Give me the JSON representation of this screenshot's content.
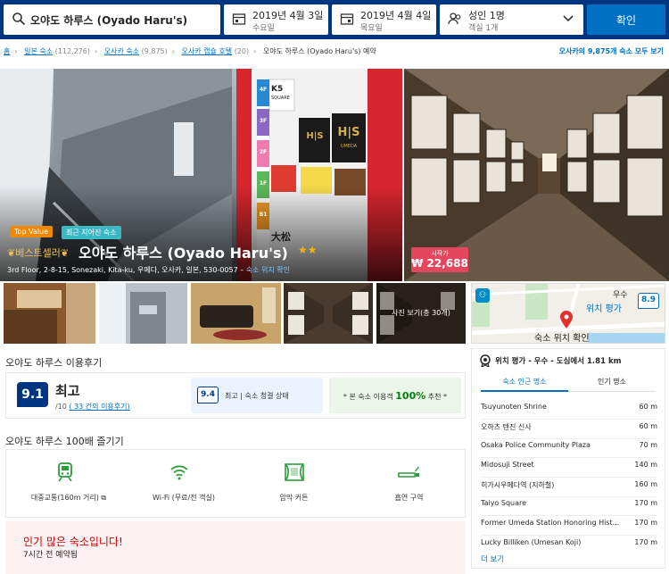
{
  "search": {
    "destination": "오야도 하루스 (Oyado Haru's)",
    "checkin_date": "2019년 4월 3일",
    "checkin_day": "수요일",
    "checkout_date": "2019년 4월 4일",
    "checkout_day": "목요일",
    "guests": "성인 1명",
    "rooms": "객실 1개",
    "submit_label": "확인"
  },
  "breadcrumb": {
    "items": [
      {
        "label": "홈",
        "count": ""
      },
      {
        "label": "일본 숙소",
        "count": "(112,276)"
      },
      {
        "label": "오사카 숙소",
        "count": "(9,875)"
      },
      {
        "label": "오사카 캡슐 호텔",
        "count": "(20)"
      }
    ],
    "current": "오야도 하루스 (Oyado Haru's) 예약",
    "all_properties_link": "오사카의 9,875개 숙소 모두 보기"
  },
  "hotel": {
    "badge_top_value": "Top Value",
    "badge_recent": "최근 지어진 숙소",
    "bestseller": "베스트셀러",
    "name": "오야도 하루스 (Oyado Haru's)",
    "stars": "★★",
    "address": "3rd Floor, 2-8-15, Sonezaki, Kita-ku, 우메다, 오사카, 일본, 530-0057",
    "address_link": "숙소 위치 확인",
    "price_from_label": "시작가",
    "price": "₩ 22,688",
    "photos_label": "사진 보기(총 30개)"
  },
  "hero_signs": {
    "floors": [
      "4F",
      "3F",
      "2F",
      "1F",
      "B1"
    ],
    "ks_square": "K5",
    "ks_sub": "SQUARE",
    "hs": "H|S",
    "hs_sub": "UMEDA",
    "daimaru": "大松"
  },
  "map": {
    "region_label": "우수",
    "region_score_label": "위치 평가",
    "score": "8.9",
    "check_location": "숙소 위치 확인"
  },
  "reviews": {
    "section_title": "오야도 하루스 이용후기",
    "score": "9.1",
    "word": "최고",
    "out_of": "/10",
    "review_count_link": "( 33 건의 이용후기)",
    "clean_score": "9.4",
    "clean_label": "최고 | 숙소 청결 상태",
    "recommend_prefix": "* 본 숙소 이용객",
    "recommend_pct": "100%",
    "recommend_suffix": "추천 *"
  },
  "amenities": {
    "section_title": "오야도 하루스 100배 즐기기",
    "items": [
      {
        "icon": "train-icon",
        "label": "대중교통(160m 거리) ⧉"
      },
      {
        "icon": "wifi-icon",
        "label": "Wi-Fi (무료/전 객실)"
      },
      {
        "icon": "blackout-curtain-icon",
        "label": "암막 커튼"
      },
      {
        "icon": "smoking-area-icon",
        "label": "흡연 구역"
      }
    ]
  },
  "popular": {
    "title": "인기 많은 숙소입니다!",
    "subtitle": "7시간 전 예약됨"
  },
  "location": {
    "header": "위치 평가 - 우수 - 도심에서 1.81 km",
    "tabs": [
      "숙소 인근 명소",
      "인기 명소"
    ],
    "landmarks": [
      {
        "name": "Tsuyunoten Shrine",
        "dist": "60 m"
      },
      {
        "name": "오하츠 텐진 신사",
        "dist": "60 m"
      },
      {
        "name": "Osaka Police Community Plaza",
        "dist": "70 m"
      },
      {
        "name": "Midosuji Street",
        "dist": "140 m"
      },
      {
        "name": "히가시우메다역 (지하철)",
        "dist": "160 m"
      },
      {
        "name": "Taiyo Square",
        "dist": "170 m"
      },
      {
        "name": "Former Umeda Station Honoring Hist...",
        "dist": "170 m"
      },
      {
        "name": "Lucky Billiken (Umesan Koji)",
        "dist": "170 m"
      }
    ],
    "more_link": "더 보기"
  },
  "colors": {
    "brand_dark": "#003580",
    "brand_blue": "#0071c2",
    "price_red": "#e4475d",
    "top_value_orange": "#f08900",
    "recent_teal": "#3bb8c3",
    "recommend_green": "#008009"
  }
}
